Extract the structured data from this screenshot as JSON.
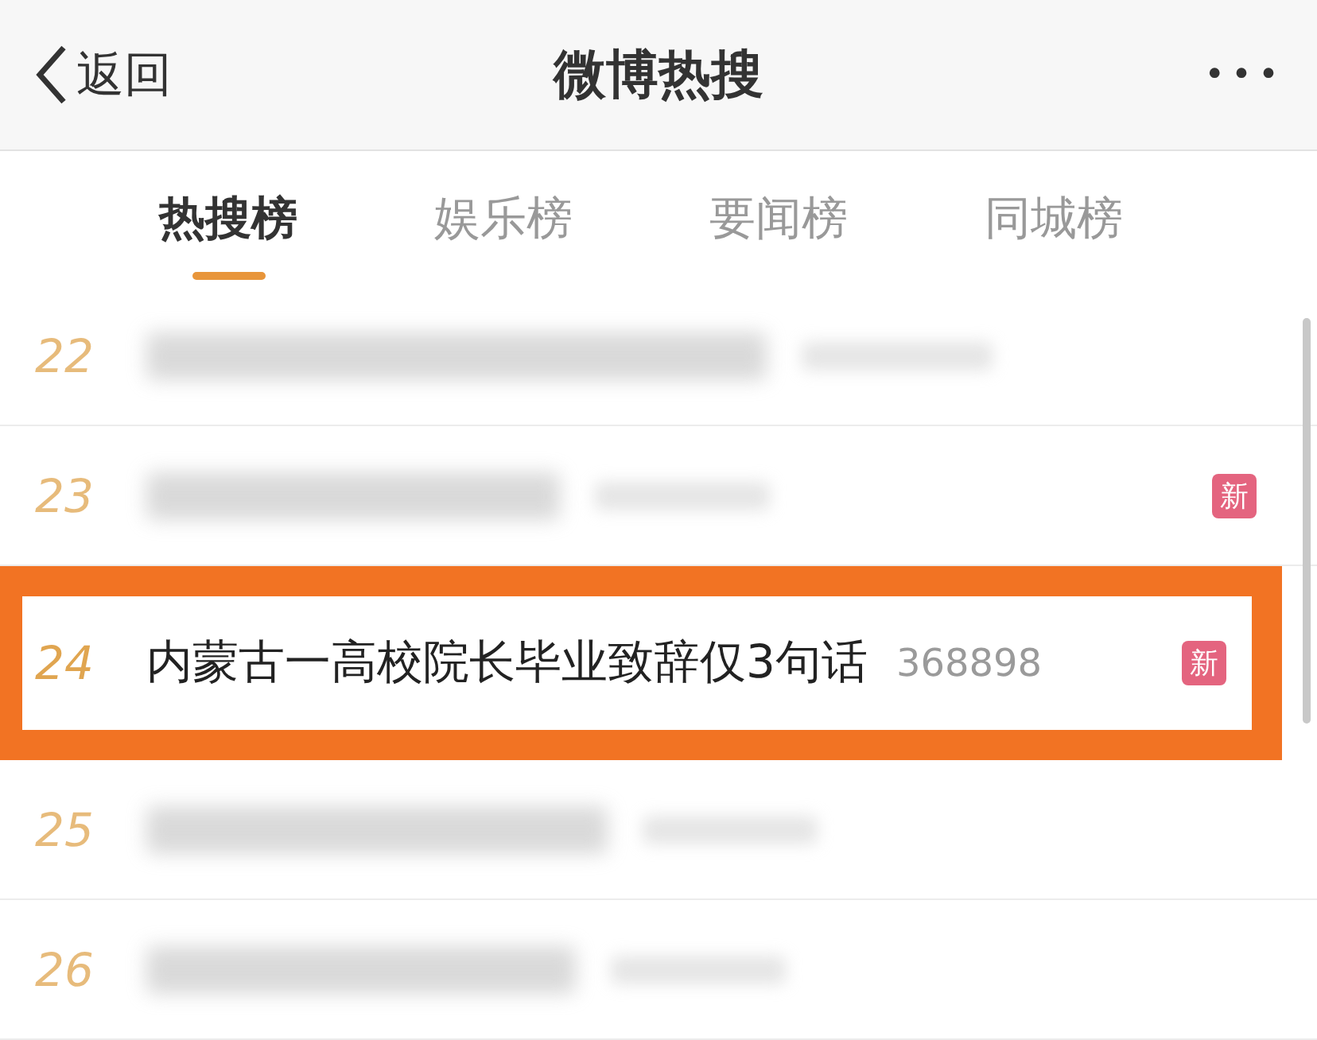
{
  "header": {
    "back": "返回",
    "title": "微博热搜",
    "more": "•••"
  },
  "tabs": [
    {
      "label": "热搜榜",
      "selected": true
    },
    {
      "label": "娱乐榜",
      "selected": false
    },
    {
      "label": "要闻榜",
      "selected": false
    },
    {
      "label": "同城榜",
      "selected": false
    }
  ],
  "rows": [
    {
      "rank": "22",
      "blurred": true,
      "highlighted": false
    },
    {
      "rank": "23",
      "blurred": true,
      "badge": "新",
      "highlighted": false
    },
    {
      "rank": "24",
      "blurred": false,
      "title": "内蒙古一高校院长毕业致辞仅3句话",
      "count": "368898",
      "badge": "新",
      "highlighted": true
    },
    {
      "rank": "25",
      "blurred": true,
      "highlighted": false
    },
    {
      "rank": "26",
      "blurred": true,
      "highlighted": false
    }
  ]
}
